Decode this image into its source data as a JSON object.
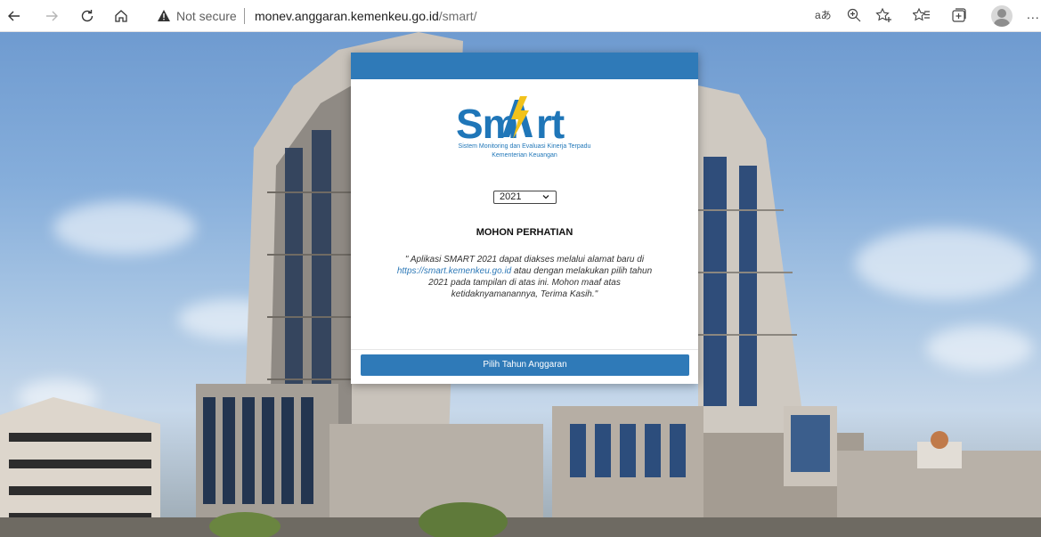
{
  "browser": {
    "security_label": "Not secure",
    "url_host": "monev.anggaran.kemenkeu.go.id",
    "url_path": "/smart/",
    "more_label": "..."
  },
  "modal": {
    "logo": {
      "wordmark_left": "Sm",
      "wordmark_right": "rt",
      "subtitle_line1": "Sistem Monitoring dan Evaluasi Kinerja Terpadu",
      "subtitle_line2": "Kementerian Keuangan"
    },
    "year_select": {
      "selected": "2021"
    },
    "notice": {
      "title": "MOHON PERHATIAN",
      "body_before_link": "\" Aplikasi SMART 2021 dapat diakses melalui alamat baru di ",
      "link_text": "https://smart.kemenkeu.go.id",
      "body_after_link": " atau dengan melakukan pilih tahun 2021 pada tampilan di atas ini. Mohon maaf atas ketidaknyamanannya, Terima Kasih.\""
    },
    "submit_label": "Pilih Tahun Anggaran"
  },
  "icons": {
    "back": "back-arrow-icon",
    "forward": "forward-arrow-icon",
    "refresh": "refresh-icon",
    "home": "home-icon",
    "warning": "warning-icon",
    "read_aloud": "read-aloud-icon",
    "zoom": "zoom-icon",
    "add_favorite": "add-favorite-icon",
    "favorites": "favorites-icon",
    "collections": "collections-icon",
    "profile": "profile-avatar-icon"
  },
  "colors": {
    "brand_blue": "#2f7ab8",
    "logo_blue": "#1f76b8",
    "logo_accent": "#f2c21b"
  }
}
